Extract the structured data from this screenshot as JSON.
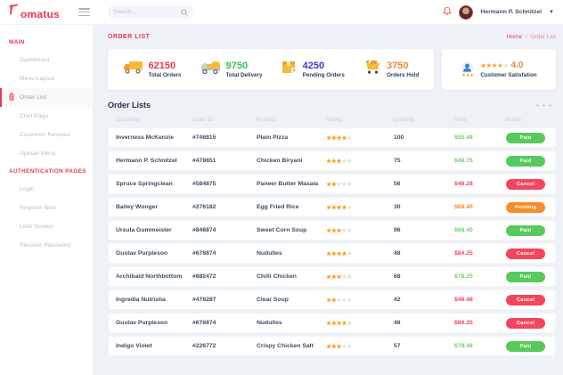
{
  "brand": {
    "name": "omatus",
    "full_name": "Tomatus",
    "accent_color": "#e8384f"
  },
  "topbar": {
    "search_placeholder": "Search...",
    "user": {
      "name": "Hermann P. Schnitzel"
    }
  },
  "sidebar": {
    "sections": [
      {
        "title": "MAIN",
        "items": [
          {
            "label": "Dashboard",
            "active": false
          },
          {
            "label": "Menu Layout",
            "active": false
          },
          {
            "label": "Order List",
            "active": true,
            "icon": "order-bag-icon"
          },
          {
            "label": "Chef Page",
            "active": false
          },
          {
            "label": "Customer Reviews",
            "active": false
          },
          {
            "label": "Upload Menu",
            "active": false
          }
        ]
      },
      {
        "title": "AUTHENTICATION PAGES",
        "items": [
          {
            "label": "Login",
            "active": false
          },
          {
            "label": "Register Now",
            "active": false
          },
          {
            "label": "Lock Screen",
            "active": false
          },
          {
            "label": "Recover Password",
            "active": false
          }
        ]
      }
    ]
  },
  "page": {
    "title": "ORDER LIST",
    "breadcrumb": {
      "home": "Home",
      "separator": "/",
      "current": "Order List"
    }
  },
  "stats": [
    {
      "value": "62150",
      "label": "Total Orders",
      "color": "#e8384f",
      "icon": "truck-icon"
    },
    {
      "value": "9750",
      "label": "Total Delivery",
      "color": "#3dbd5d",
      "icon": "delivery-truck-icon"
    },
    {
      "value": "4250",
      "label": "Pending Orders",
      "color": "#4535d1",
      "icon": "package-box-icon"
    },
    {
      "value": "3750",
      "label": "Orders Hold",
      "color": "#f0883a",
      "icon": "cart-icon"
    }
  ],
  "satisfaction": {
    "value": "4.0",
    "stars_filled": 4,
    "stars_total": 5,
    "mini_stars": 3,
    "label": "Customer Satisfation",
    "icon": "customer-person-icon"
  },
  "orders": {
    "title": "Order Lists",
    "menu_dots": "• • •",
    "columns": [
      "Customer",
      "Order ID",
      "Product",
      "Rating",
      "Quantity",
      "Price",
      "Status"
    ],
    "stars_total": 5,
    "status_colors": {
      "Paid": "#56ca5c",
      "Cancel": "#f5455c",
      "Pending": "#f78c2a"
    },
    "rows": [
      {
        "customer": "Inverness McKenzie",
        "order_id": "#746815",
        "product": "Plain Pizza",
        "rating": 4,
        "quantity": "100",
        "price": "$55.48",
        "price_color": "green",
        "status": "Paid"
      },
      {
        "customer": "Hermann P. Schnitzel",
        "order_id": "#478651",
        "product": "Chicken Biryani",
        "rating": 3,
        "quantity": "75",
        "price": "$48.75",
        "price_color": "green",
        "status": "Paid"
      },
      {
        "customer": "Spruce Springclean",
        "order_id": "#584875",
        "product": "Paneer Butter Masala",
        "rating": 2,
        "quantity": "56",
        "price": "$48.28",
        "price_color": "red",
        "status": "Cancel"
      },
      {
        "customer": "Bailey Wonger",
        "order_id": "#276182",
        "product": "Egg Fried Rice",
        "rating": 4,
        "quantity": "30",
        "price": "$68.40",
        "price_color": "orange",
        "status": "Pending"
      },
      {
        "customer": "Ursula Gummeister",
        "order_id": "#846874",
        "product": "Sweet Corn Soup",
        "rating": 3,
        "quantity": "96",
        "price": "$68.40",
        "price_color": "green",
        "status": "Paid"
      },
      {
        "customer": "Gustav Purpleson",
        "order_id": "#676874",
        "product": "Nudulles",
        "rating": 4,
        "quantity": "48",
        "price": "$84.25",
        "price_color": "red",
        "status": "Cancel"
      },
      {
        "customer": "Archibald Northbottom",
        "order_id": "#682472",
        "product": "Chilli Chicken",
        "rating": 3,
        "quantity": "68",
        "price": "$78.25",
        "price_color": "green",
        "status": "Paid"
      },
      {
        "customer": "Ingredia Nutrisha",
        "order_id": "#476287",
        "product": "Clear Soup",
        "rating": 2,
        "quantity": "42",
        "price": "$48.48",
        "price_color": "red",
        "status": "Cancel"
      },
      {
        "customer": "Gustav Purpleson",
        "order_id": "#676874",
        "product": "Nudulles",
        "rating": 4,
        "quantity": "48",
        "price": "$84.25",
        "price_color": "red",
        "status": "Cancel"
      },
      {
        "customer": "Indigo Violet",
        "order_id": "#226772",
        "product": "Crispy Chicken Salt",
        "rating": 3,
        "quantity": "57",
        "price": "$78.48",
        "price_color": "green",
        "status": "Paid"
      }
    ]
  }
}
